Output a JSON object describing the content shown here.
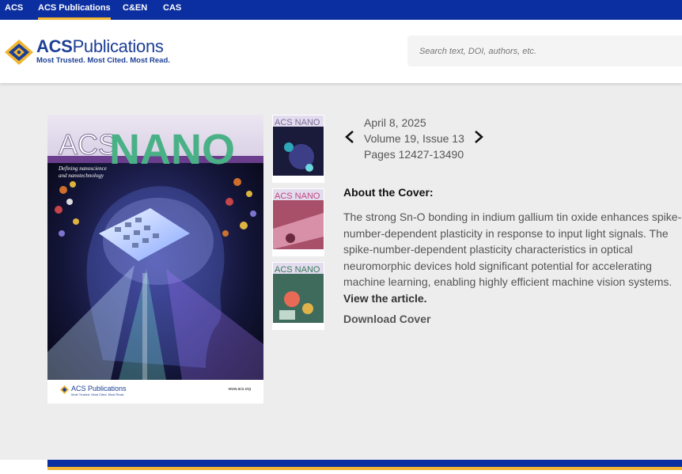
{
  "topnav": {
    "links": [
      {
        "label": "ACS"
      },
      {
        "label": "ACS Publications",
        "active": true
      },
      {
        "label": "C&EN"
      },
      {
        "label": "CAS"
      }
    ],
    "accent_color": "#f2b632",
    "bg_color": "#0b2ea0"
  },
  "header": {
    "logo": {
      "name_bold": "ACS",
      "name_rest": "Publications",
      "tagline": "Most Trusted. Most Cited. Most Read."
    },
    "search": {
      "placeholder": "Search text, DOI, authors, etc."
    }
  },
  "cover": {
    "journal_prefix": "ACS",
    "journal_name": "NANO",
    "subtitle_line1": "Defining nanoscience",
    "subtitle_line2": "and nanotechnology",
    "footer_logo": "ACS Publications",
    "footer_tagline": "Most Trusted. Most Cited. Most Read.",
    "footer_url": "www.acs.org"
  },
  "thumbnails": [
    {
      "label": "ACS NANO"
    },
    {
      "label": "ACS NANO"
    },
    {
      "label": "ACS NANO"
    }
  ],
  "issue": {
    "date": "April 8, 2025",
    "volume_issue": "Volume 19, Issue 13",
    "pages": "Pages 12427-13490",
    "prev_icon": "chevron-left-icon",
    "next_icon": "chevron-right-icon"
  },
  "about": {
    "heading": "About the Cover:",
    "lines": [
      "The strong Sn-O bonding in indium gallium tin oxide enhances spike-",
      "number-dependent plasticity in response to input light signals. The",
      "spike-number-dependent plasticity characteristics in optical",
      "neuromorphic devices hold significant potential for accelerating",
      "machine learning, enabling highly efficient machine vision systems."
    ],
    "view_link": "View the article.",
    "download": "Download Cover"
  }
}
